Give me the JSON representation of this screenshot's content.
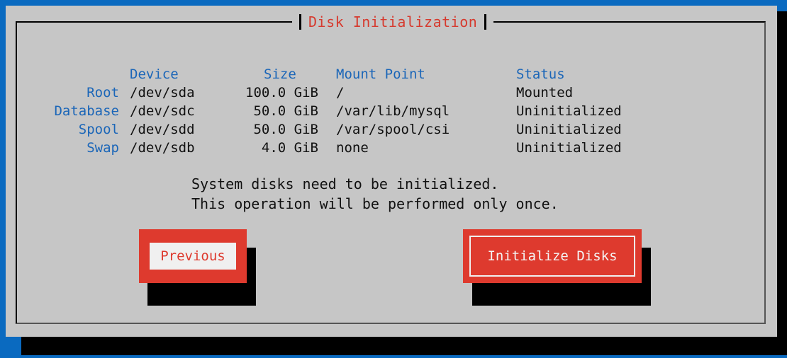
{
  "dialog": {
    "title": "Disk Initialization"
  },
  "table": {
    "headers": {
      "device": "Device",
      "size": "Size",
      "mount": "Mount Point",
      "status": "Status"
    },
    "rows": [
      {
        "label": "Root",
        "device": "/dev/sda",
        "size": "100.0 GiB",
        "mount": "/",
        "status": "Mounted"
      },
      {
        "label": "Database",
        "device": "/dev/sdc",
        "size": "50.0 GiB",
        "mount": "/var/lib/mysql",
        "status": "Uninitialized"
      },
      {
        "label": "Spool",
        "device": "/dev/sdd",
        "size": "50.0 GiB",
        "mount": "/var/spool/csi",
        "status": "Uninitialized"
      },
      {
        "label": "Swap",
        "device": "/dev/sdb",
        "size": "4.0 GiB",
        "mount": "none",
        "status": "Uninitialized"
      }
    ]
  },
  "message": {
    "line1": "System disks need to be initialized.",
    "line2": "This operation will be performed only once."
  },
  "buttons": {
    "previous": "Previous",
    "initialize": "Initialize Disks"
  },
  "colors": {
    "background": "#0a6ac0",
    "dialog": "#c6c6c6",
    "accent": "#de3a2e",
    "label": "#1b66b8"
  }
}
